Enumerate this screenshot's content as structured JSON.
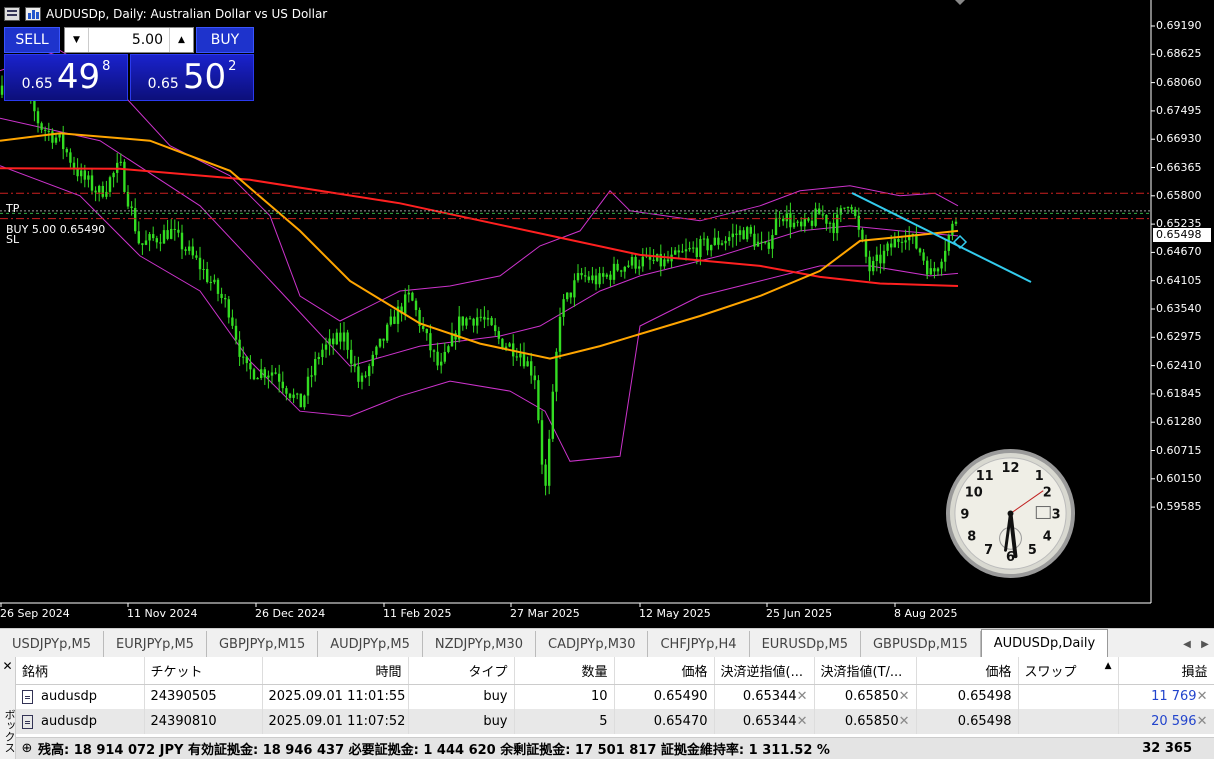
{
  "window": {
    "title": "AUDUSDp, Daily:  Australian Dollar vs US Dollar"
  },
  "trade_panel": {
    "sell_label": "SELL",
    "buy_label": "BUY",
    "lot_value": "5.00",
    "sell_price_small": "0.65",
    "sell_price_big": "49",
    "sell_price_sup": "8",
    "buy_price_small": "0.65",
    "buy_price_big": "50",
    "buy_price_sup": "2"
  },
  "chart": {
    "line_labels": {
      "tp": "TP",
      "buy": "BUY 5.00 0.65490",
      "sl": "SL"
    },
    "current_price": "0.65498",
    "colors": {
      "candles": "#33dd22",
      "bollinger": "#cc33cc",
      "ma_fast": "#ffa500",
      "ma_slow": "#ff2020",
      "trendline": "#33ccee",
      "tp_line": "#cc2020",
      "bid_line": "#a0a0a0"
    }
  },
  "chart_data": {
    "type": "candlestick",
    "symbol": "AUDUSDp",
    "timeframe": "Daily",
    "y_ticks": [
      "0.69190",
      "0.68625",
      "0.68060",
      "0.67495",
      "0.66930",
      "0.66365",
      "0.65800",
      "0.65235",
      "0.64670",
      "0.64105",
      "0.63540",
      "0.62975",
      "0.62410",
      "0.61845",
      "0.61280",
      "0.60715",
      "0.60150",
      "0.59585"
    ],
    "x_ticks": [
      "26 Sep 2024",
      "11 Nov 2024",
      "26 Dec 2024",
      "11 Feb 2025",
      "27 Mar 2025",
      "12 May 2025",
      "25 Jun 2025",
      "8 Aug 2025"
    ],
    "ylim": [
      0.5925,
      0.6947
    ],
    "levels": {
      "tp": 0.6585,
      "bid": 0.65498,
      "sl": 0.65344
    }
  },
  "tabs": [
    "USDJPYp,M5",
    "EURJPYp,M5",
    "GBPJPYp,M15",
    "AUDJPYp,M5",
    "NZDJPYp,M30",
    "CADJPYp,M30",
    "CHFJPYp,H4",
    "EURUSDp,M5",
    "GBPUSDp,M15",
    "AUDUSDp,Daily"
  ],
  "terminal": {
    "side_label": "ボックス",
    "headers": [
      "銘柄",
      "チケット",
      "時間",
      "タイプ",
      "数量",
      "価格",
      "決済逆指値(...",
      "決済指値(T/...",
      "価格",
      "スワップ",
      "損益"
    ],
    "rows": [
      {
        "symbol": "audusdp",
        "ticket": "24390505",
        "time": "2025.09.01 11:01:55",
        "type": "buy",
        "volume": "10",
        "price": "0.65490",
        "sl": "0.65344",
        "tp": "0.65850",
        "current": "0.65498",
        "swap": "",
        "profit": "11 769"
      },
      {
        "symbol": "audusdp",
        "ticket": "24390810",
        "time": "2025.09.01 11:07:52",
        "type": "buy",
        "volume": "5",
        "price": "0.65470",
        "sl": "0.65344",
        "tp": "0.65850",
        "current": "0.65498",
        "swap": "",
        "profit": "20 596"
      }
    ],
    "balance_text": "残高: 18 914 072 JPY  有効証拠金: 18 946 437  必要証拠金: 1 444 620  余剰証拠金: 17 501 817  証拠金維持率: 1 311.52 %",
    "total_profit": "32 365"
  }
}
